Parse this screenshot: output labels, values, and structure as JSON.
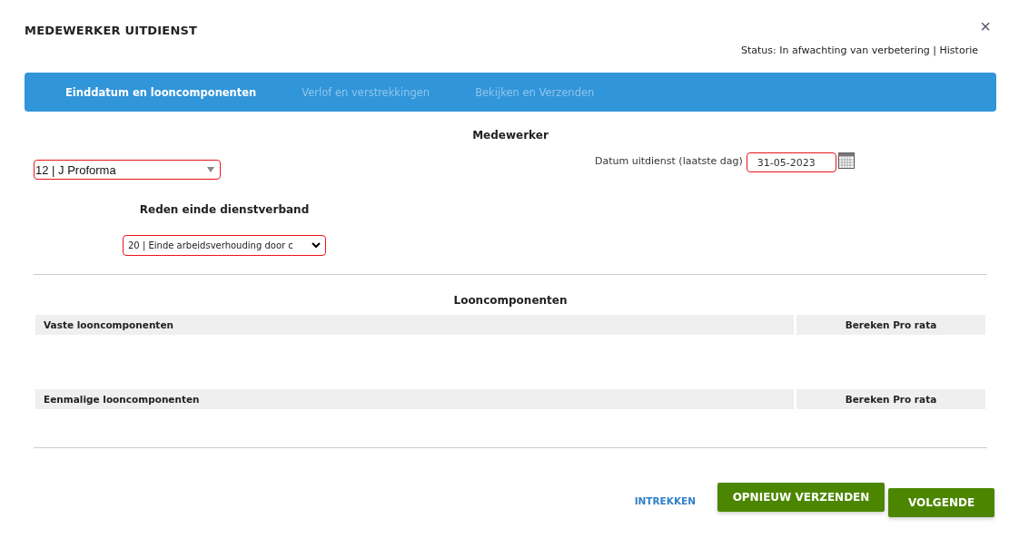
{
  "dialog": {
    "title": "MEDEWERKER UITDIENST",
    "close": "×",
    "status": "Status: In afwachting van verbetering | Historie"
  },
  "steps": [
    {
      "label": "Einddatum en looncomponenten",
      "selected": true
    },
    {
      "label": "Verlof en verstrekkingen",
      "selected": false
    },
    {
      "label": "Bekijken en Verzenden",
      "selected": false
    }
  ],
  "employee": {
    "heading": "Medewerker",
    "select": {
      "value": "12 | J Proforma",
      "invalid": true
    },
    "date": {
      "label": "Datum uitdienst (laatste dag)",
      "value": "31-05-2023",
      "invalid": true
    }
  },
  "reason": {
    "heading": "Reden einde dienstverband",
    "select": {
      "value": "20 | Einde arbeidsverhouding door c",
      "invalid": true
    }
  },
  "components": {
    "heading": "Looncomponenten",
    "tables": [
      {
        "columns": [
          "Vaste looncomponenten",
          "Bereken Pro rata"
        ]
      },
      {
        "columns": [
          "Eenmalige looncomponenten",
          "Bereken Pro rata"
        ]
      }
    ]
  },
  "buttons": {
    "link": "INTREKKEN",
    "resend": "OPNIEUW VERZENDEN",
    "next": "VOLGENDE"
  }
}
